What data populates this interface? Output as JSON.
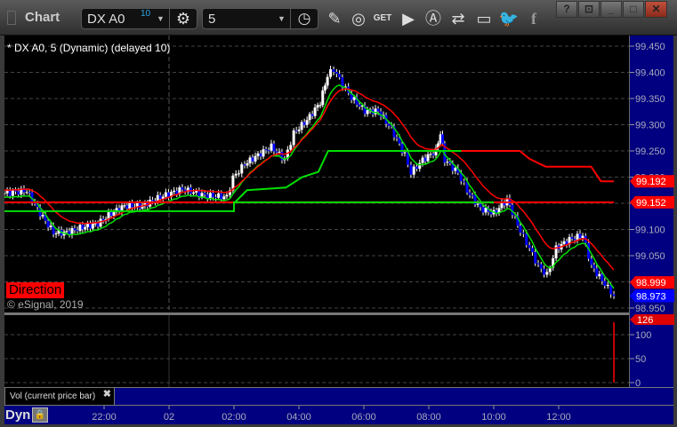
{
  "window": {
    "title": "Chart",
    "help": "?",
    "icons": [
      "restore-down-icon",
      "minimize-icon",
      "maximize-icon",
      "close-icon"
    ]
  },
  "toolbar": {
    "symbol": "DX A0",
    "symbol_badge": "10",
    "interval": "5",
    "icons": [
      "settings-gear-icon",
      "clock-icon",
      "pencil-draw-icon",
      "study-icon",
      "get-icon",
      "play-icon",
      "alert-icon",
      "link-icon",
      "chat-icon",
      "twitter-icon",
      "facebook-icon"
    ]
  },
  "chart": {
    "legend": "* DX A0, 5 (Dynamic) (delayed 10)",
    "direction_label": "Direction",
    "copyright": "© eSignal, 2019",
    "colors": {
      "up": "#ffffff",
      "down": "#0000ff",
      "ma_red": "#ff0000",
      "ma_green": "#00e000",
      "axis_bg": "#000080"
    }
  },
  "price_axis": {
    "ticks": [
      "99.450",
      "99.400",
      "99.350",
      "99.300",
      "99.250",
      "99.200",
      "99.150",
      "99.100",
      "99.050",
      "99.000",
      "98.950"
    ],
    "badges": [
      {
        "value": "99.192",
        "color": "#ff0000"
      },
      {
        "value": "99.152",
        "color": "#ff0000"
      },
      {
        "value": "98.999",
        "color": "#ff0000"
      },
      {
        "value": "98.973",
        "color": "#0000ff"
      }
    ]
  },
  "volume": {
    "tab_label": "Vol (current price bar)",
    "close_label": "✖",
    "ticks": [
      "100",
      "50",
      "0"
    ],
    "badge": "126",
    "last_volume": 126
  },
  "time_axis": {
    "mode": "Dyn",
    "ticks": [
      {
        "label": "22:00",
        "t": 22
      },
      {
        "label": "02",
        "t": 24
      },
      {
        "label": "02:00",
        "t": 26
      },
      {
        "label": "04:00",
        "t": 28
      },
      {
        "label": "06:00",
        "t": 30
      },
      {
        "label": "08:00",
        "t": 32
      },
      {
        "label": "10:00",
        "t": 34
      },
      {
        "label": "12:00",
        "t": 36
      }
    ]
  },
  "chart_data": {
    "type": "candlestick",
    "x_unit": "hours since prior midnight",
    "ylim": [
      98.95,
      99.45
    ],
    "close_path": [
      [
        18.93,
        99.169
      ],
      [
        19.62,
        99.174
      ],
      [
        20.03,
        99.131
      ],
      [
        20.44,
        99.094
      ],
      [
        20.85,
        99.094
      ],
      [
        21.26,
        99.103
      ],
      [
        21.81,
        99.111
      ],
      [
        22.22,
        99.131
      ],
      [
        22.63,
        99.145
      ],
      [
        23.18,
        99.145
      ],
      [
        23.73,
        99.162
      ],
      [
        24.41,
        99.177
      ],
      [
        25.1,
        99.165
      ],
      [
        25.78,
        99.162
      ],
      [
        25.97,
        99.199
      ],
      [
        26.33,
        99.225
      ],
      [
        26.74,
        99.242
      ],
      [
        27.15,
        99.258
      ],
      [
        27.56,
        99.233
      ],
      [
        27.84,
        99.284
      ],
      [
        28.25,
        99.309
      ],
      [
        28.66,
        99.343
      ],
      [
        28.88,
        99.394
      ],
      [
        29.07,
        99.406
      ],
      [
        29.34,
        99.377
      ],
      [
        29.62,
        99.352
      ],
      [
        30.03,
        99.326
      ],
      [
        30.44,
        99.326
      ],
      [
        30.85,
        99.292
      ],
      [
        31.26,
        99.242
      ],
      [
        31.45,
        99.208
      ],
      [
        31.81,
        99.233
      ],
      [
        32.22,
        99.25
      ],
      [
        32.36,
        99.284
      ],
      [
        32.49,
        99.233
      ],
      [
        32.9,
        99.208
      ],
      [
        33.18,
        99.174
      ],
      [
        33.59,
        99.14
      ],
      [
        34.0,
        99.131
      ],
      [
        34.41,
        99.157
      ],
      [
        34.82,
        99.097
      ],
      [
        35.1,
        99.064
      ],
      [
        35.37,
        99.03
      ],
      [
        35.64,
        99.013
      ],
      [
        35.92,
        99.064
      ],
      [
        36.33,
        99.081
      ],
      [
        36.74,
        99.089
      ],
      [
        37.01,
        99.03
      ],
      [
        37.42,
        98.996
      ],
      [
        37.7,
        98.973
      ]
    ],
    "red_step": [
      [
        18.93,
        99.152
      ],
      [
        37.7,
        99.152
      ]
    ],
    "red_step_high": [
      [
        28.9,
        99.25
      ],
      [
        34.8,
        99.25
      ],
      [
        35.1,
        99.235
      ],
      [
        35.6,
        99.22
      ],
      [
        37.0,
        99.22
      ],
      [
        37.3,
        99.192
      ],
      [
        37.7,
        99.192
      ]
    ],
    "green_step": [
      [
        18.93,
        99.135
      ],
      [
        26.0,
        99.135
      ],
      [
        26.0,
        99.152
      ],
      [
        34.0,
        99.152
      ]
    ],
    "green_step_high": [
      [
        26.0,
        99.15
      ],
      [
        26.4,
        99.175
      ],
      [
        27.6,
        99.18
      ],
      [
        28.1,
        99.2
      ],
      [
        28.6,
        99.21
      ],
      [
        28.9,
        99.25
      ],
      [
        33.0,
        99.25
      ]
    ]
  }
}
